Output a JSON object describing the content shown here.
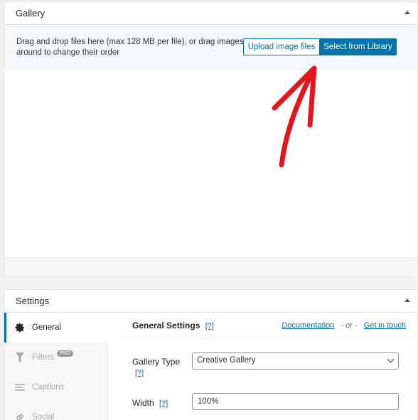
{
  "gallery": {
    "title": "Gallery",
    "dropzone_text_1": "Drag and drop files here (max 128 MB per file), or drag images",
    "dropzone_text_2": "around to change their order",
    "upload_label": "Upload image files",
    "library_label": "Select from Library"
  },
  "settings": {
    "title": "Settings",
    "tabs": [
      {
        "label": "General",
        "icon": "gear-icon",
        "active": true
      },
      {
        "label": "Filters",
        "icon": "filter-icon",
        "badge": "PRO"
      },
      {
        "label": "Captions",
        "icon": "captions-icon"
      },
      {
        "label": "Social",
        "icon": "link-icon"
      }
    ],
    "content": {
      "title": "General Settings",
      "title_help": "[?]",
      "documentation_link": "Documentation",
      "separator": "- or -",
      "contact_link": "Get in touch",
      "gallery_type_label": "Gallery Type",
      "gallery_type_help": "[?]",
      "gallery_type_value": "Creative Gallery",
      "width_label": "Width",
      "width_help": "[?]",
      "width_value": "100%"
    }
  },
  "colors": {
    "accent": "#0073aa",
    "annotation_arrow": "#e8141c"
  }
}
